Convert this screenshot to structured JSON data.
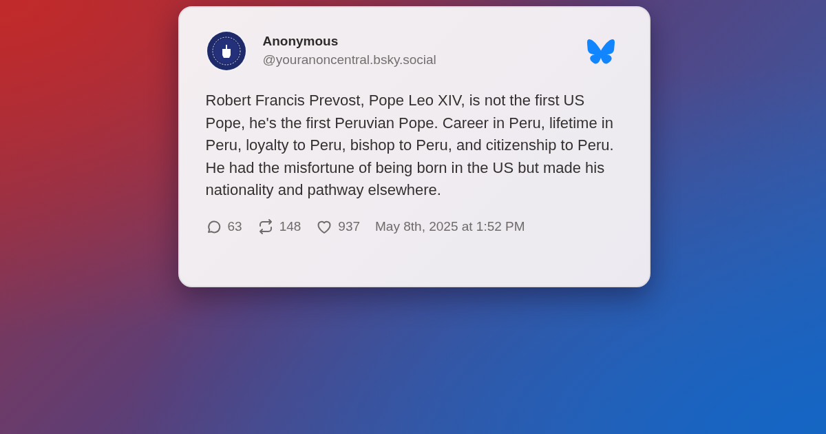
{
  "post": {
    "author": {
      "name": "Anonymous",
      "handle": "@youranoncentral.bsky.social"
    },
    "text": "Robert Francis Prevost, Pope Leo XIV, is not the first US Pope, he's the first Peruvian Pope. Career in Peru, lifetime in Peru, loyalty to Peru, bishop to Peru, and citizenship to Peru. He had the misfortune of being born in the US but made his nationality and pathway elsewhere.",
    "stats": [
      {
        "kind": "reply",
        "count": "63"
      },
      {
        "kind": "repost",
        "count": "148"
      },
      {
        "kind": "like",
        "count": "937"
      }
    ],
    "timestamp": "May 8th, 2025 at 1:52 PM"
  }
}
